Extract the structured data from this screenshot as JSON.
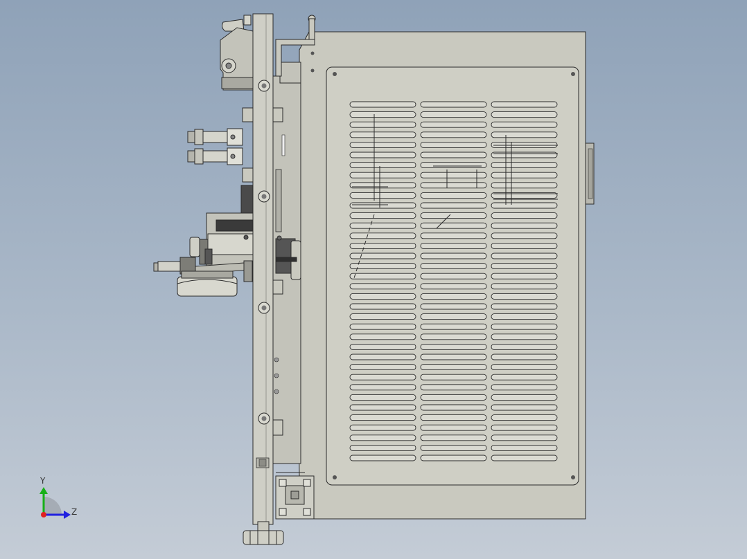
{
  "viewport": {
    "view": "side",
    "colors": {
      "background_top": "#8fa2b8",
      "background_bottom": "#c4ccd6",
      "housing_fill": "#c9c9bf",
      "panel_fill": "#cfcfc5",
      "slot_fill": "#dadad2",
      "edge": "#2b2b2b",
      "dark_part": "#3a3a3a",
      "mid_part": "#9a9a92"
    },
    "vent_grid": {
      "columns": 3,
      "rows": 36
    }
  },
  "triad": {
    "y_label": "Y",
    "z_label": "Z",
    "colors": {
      "y": "#18b018",
      "z": "#2020e0",
      "x": "#e02020"
    }
  }
}
